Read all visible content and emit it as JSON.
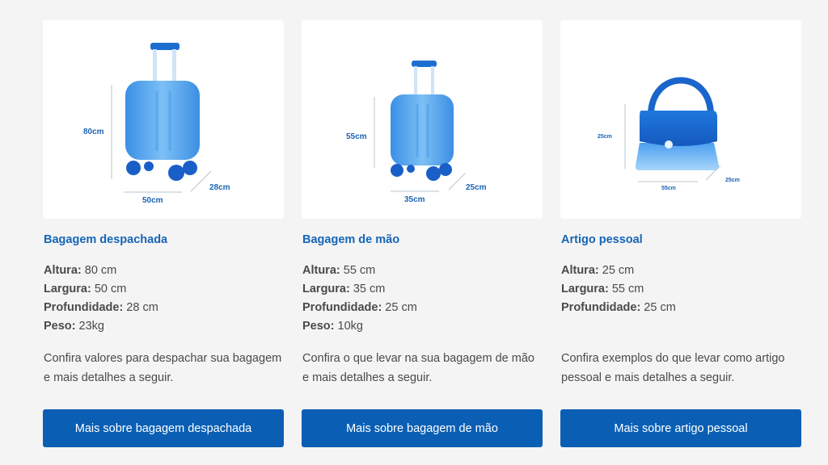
{
  "cards": [
    {
      "title": "Bagagem despachada",
      "specs": [
        {
          "label": "Altura:",
          "value": " 80 cm"
        },
        {
          "label": "Largura:",
          "value": " 50 cm"
        },
        {
          "label": "Profundidade:",
          "value": " 28 cm"
        },
        {
          "label": "Peso:",
          "value": " 23kg"
        }
      ],
      "description": "Confira valores para despachar sua bagagem e mais detalhes a seguir.",
      "button": "Mais sobre bagagem despachada",
      "dims": {
        "height": "80cm",
        "width": "50cm",
        "depth": "28cm"
      }
    },
    {
      "title": "Bagagem de mão",
      "specs": [
        {
          "label": "Altura:",
          "value": " 55 cm"
        },
        {
          "label": "Largura:",
          "value": " 35 cm"
        },
        {
          "label": "Profundidade:",
          "value": " 25 cm"
        },
        {
          "label": "Peso:",
          "value": " 10kg"
        }
      ],
      "description": "Confira o que levar na sua bagagem de mão e mais detalhes a seguir.",
      "button": "Mais sobre bagagem de mão",
      "dims": {
        "height": "55cm",
        "width": "35cm",
        "depth": "25cm"
      }
    },
    {
      "title": "Artigo pessoal",
      "specs": [
        {
          "label": "Altura:",
          "value": " 25 cm"
        },
        {
          "label": "Largura:",
          "value": " 55 cm"
        },
        {
          "label": "Profundidade:",
          "value": " 25 cm"
        }
      ],
      "description": "Confira exemplos do que levar como artigo pessoal e mais detalhes a seguir.",
      "button": "Mais sobre artigo pessoal",
      "dims": {
        "height": "25cm",
        "width": "55cm",
        "depth": "25cm"
      }
    }
  ],
  "colors": {
    "accent": "#1565b5",
    "button": "#0a5fb4",
    "background": "#f4f4f5",
    "text": "#4a4a4a"
  }
}
